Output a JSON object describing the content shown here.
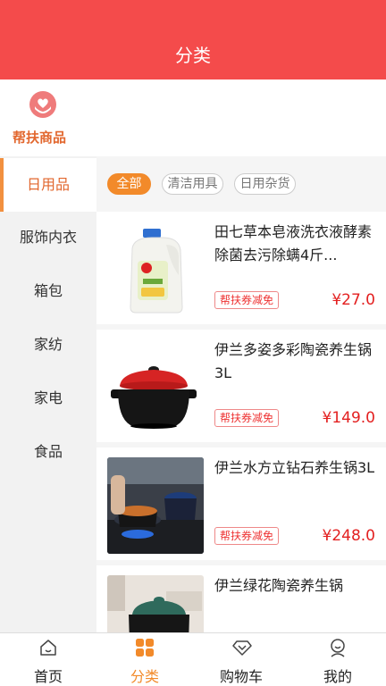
{
  "header": {
    "title": "分类"
  },
  "brand": {
    "label": "帮扶商品"
  },
  "categories": [
    {
      "label": "日用品",
      "active": true
    },
    {
      "label": "服饰内衣"
    },
    {
      "label": "箱包"
    },
    {
      "label": "家纺"
    },
    {
      "label": "家电"
    },
    {
      "label": "食品"
    }
  ],
  "subtabs": [
    "全部",
    "清洁用具",
    "日用杂货"
  ],
  "products": [
    {
      "title": "田七草本皂液洗衣液酵素除菌去污除螨4斤...",
      "badge": "帮扶券减免",
      "price": "¥27.0",
      "image": "laundry-detergent-bottle"
    },
    {
      "title": "伊兰多姿多彩陶瓷养生锅3L",
      "badge": "帮扶券减免",
      "price": "¥149.0",
      "image": "red-lid-ceramic-pot"
    },
    {
      "title": "伊兰水方立钻石养生锅3L",
      "badge": "帮扶券减免",
      "price": "¥248.0",
      "image": "pot-on-stove-photo"
    },
    {
      "title": "伊兰绿花陶瓷养生锅",
      "badge": "",
      "price": "",
      "image": "green-lid-pot-photo"
    }
  ],
  "tabbar": [
    {
      "label": "首页",
      "icon": "home-icon"
    },
    {
      "label": "分类",
      "icon": "category-icon",
      "active": true
    },
    {
      "label": "购物车",
      "icon": "diamond-icon"
    },
    {
      "label": "我的",
      "icon": "profile-icon"
    }
  ],
  "colors": {
    "header": "#f44b4b",
    "accent": "#f28a2a",
    "price": "#e32020",
    "brand": "#e2672e"
  }
}
